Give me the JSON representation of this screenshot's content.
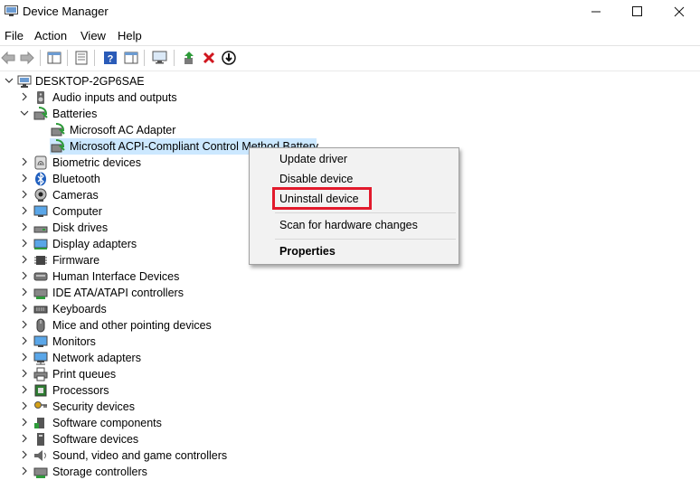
{
  "window": {
    "title": "Device Manager"
  },
  "menu": [
    "File",
    "Action",
    "View",
    "Help"
  ],
  "tree": {
    "root": "DESKTOP-2GP6SAE",
    "batteries_children": [
      "Microsoft AC Adapter",
      "Microsoft ACPI-Compliant Control Method Battery"
    ],
    "categories": [
      "Audio inputs and outputs",
      "Batteries",
      "Biometric devices",
      "Bluetooth",
      "Cameras",
      "Computer",
      "Disk drives",
      "Display adapters",
      "Firmware",
      "Human Interface Devices",
      "IDE ATA/ATAPI controllers",
      "Keyboards",
      "Mice and other pointing devices",
      "Monitors",
      "Network adapters",
      "Print queues",
      "Processors",
      "Security devices",
      "Software components",
      "Software devices",
      "Sound, video and game controllers",
      "Storage controllers"
    ]
  },
  "context_menu": {
    "update": "Update driver",
    "disable": "Disable device",
    "uninstall": "Uninstall device",
    "scan": "Scan for hardware changes",
    "properties": "Properties"
  },
  "colors": {
    "selection": "#cce8ff",
    "highlight": "#e21a2c"
  }
}
